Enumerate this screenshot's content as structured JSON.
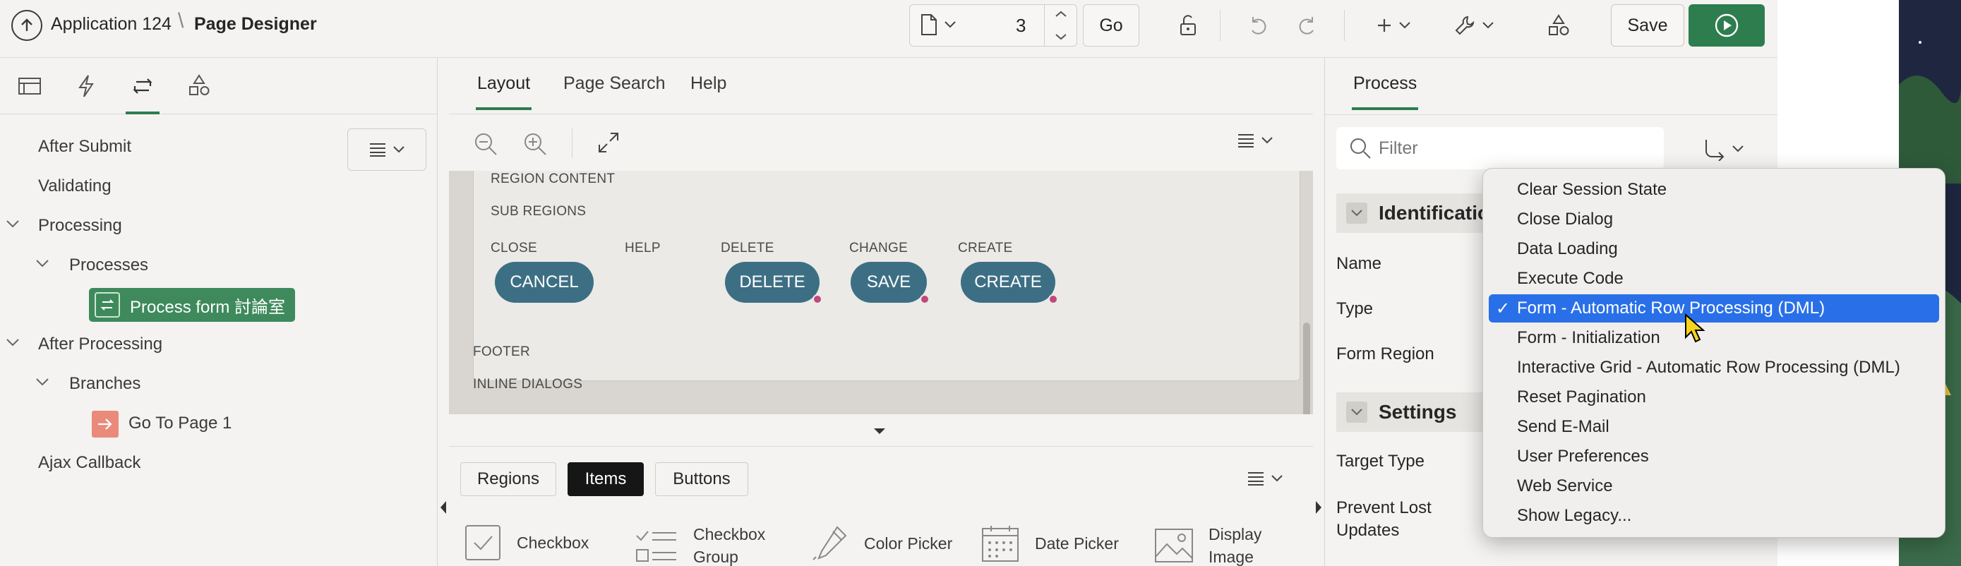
{
  "header": {
    "app_name": "Application 124",
    "separator": "\\",
    "page_title": "Page Designer",
    "page_number": "3",
    "go_label": "Go",
    "save_label": "Save"
  },
  "left_panel": {
    "menu_icon": "hamburger-icon",
    "tree": [
      {
        "label": "After Submit",
        "level": 0
      },
      {
        "label": "Validating",
        "level": 0
      },
      {
        "label": "Processing",
        "level": 0,
        "expanded": true
      },
      {
        "label": "Processes",
        "level": 1,
        "expanded": true
      },
      {
        "label": "Process form 討論室",
        "level": 2,
        "selected": true
      },
      {
        "label": "After Processing",
        "level": 0,
        "expanded": true
      },
      {
        "label": "Branches",
        "level": 1,
        "expanded": true
      },
      {
        "label": "Go To Page 1",
        "level": 2
      },
      {
        "label": "Ajax Callback",
        "level": 0
      }
    ]
  },
  "middle_panel": {
    "tabs": [
      "Layout",
      "Page Search",
      "Help"
    ],
    "active_tab": "Layout",
    "canvas": {
      "region_content": "REGION CONTENT",
      "sub_regions": "SUB REGIONS",
      "slots": [
        "CLOSE",
        "HELP",
        "DELETE",
        "CHANGE",
        "CREATE"
      ],
      "buttons": [
        "CANCEL",
        "DELETE",
        "SAVE",
        "CREATE"
      ],
      "footer": "FOOTER",
      "inline_dialogs": "INLINE DIALOGS"
    },
    "palette": {
      "tabs": [
        "Regions",
        "Items",
        "Buttons"
      ],
      "active_tab": "Items",
      "items": [
        "Checkbox",
        "Checkbox Group",
        "Color Picker",
        "Date Picker",
        "Display Image"
      ],
      "items_lines": [
        [
          "Checkbox"
        ],
        [
          "Checkbox",
          "Group"
        ],
        [
          "Color Picker"
        ],
        [
          "Date Picker"
        ],
        [
          "Display",
          "Image"
        ]
      ]
    }
  },
  "right_panel": {
    "tab": "Process",
    "filter_placeholder": "Filter",
    "sections": {
      "identification": "Identification",
      "settings": "Settings"
    },
    "props": {
      "name": "Name",
      "type": "Type",
      "form_region": "Form Region",
      "target_type": "Target Type",
      "prevent_lost_1": "Prevent Lost",
      "prevent_lost_2": "Updates"
    }
  },
  "dropdown": {
    "selected": "Form - Automatic Row Processing (DML)",
    "check": "✓",
    "options": [
      "Clear Session State",
      "Close Dialog",
      "Data Loading",
      "Execute Code",
      "Form - Automatic Row Processing (DML)",
      "Form - Initialization",
      "Interactive Grid - Automatic Row Processing (DML)",
      "Reset Pagination",
      "Send E-Mail",
      "User Preferences",
      "Web Service",
      "Show Legacy..."
    ]
  },
  "colors": {
    "accent_green": "#2e7d4f",
    "button_teal": "#3d6f84",
    "selection_blue": "#2970e8"
  }
}
